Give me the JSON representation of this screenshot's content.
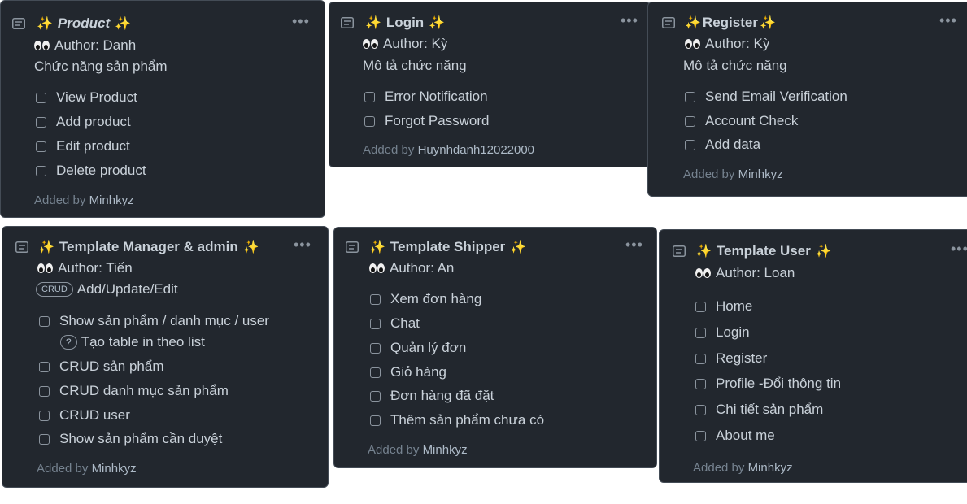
{
  "cards": [
    {
      "title": "Product",
      "author": "Author: Danh",
      "desc": "Chức năng sản phẩm",
      "tasks": [
        "View Product",
        "Add product",
        "Edit product",
        "Delete product"
      ],
      "added_prefix": "Added by",
      "added_by": "Minhkyz"
    },
    {
      "title": "Login",
      "author": "Author: Kỳ",
      "desc": "Mô tả chức năng",
      "tasks": [
        "Error Notification",
        "Forgot Password"
      ],
      "added_prefix": "Added by",
      "added_by": "Huynhdanh12022000"
    },
    {
      "title": "Register",
      "author": "Author: Kỳ",
      "desc": "Mô tả chức năng",
      "tasks": [
        "Send Email Verification",
        "Account Check",
        "Add data"
      ],
      "added_prefix": "Added by",
      "added_by": "Minhkyz"
    },
    {
      "title": "Template Manager & admin",
      "author": "Author: Tiến",
      "badge": "CRUD",
      "desc": "Add/Update/Edit",
      "tasks": [
        "Show sản phẩm / danh mục / user",
        "CRUD sản phẩm",
        "CRUD danh mục sản phẩm",
        "CRUD user",
        "Show sản phẩm cần duyệt"
      ],
      "subnote_badge": "?",
      "subnote": "Tạo table in theo list",
      "added_prefix": "Added by",
      "added_by": "Minhkyz"
    },
    {
      "title": "Template Shipper",
      "author": "Author: An",
      "tasks": [
        "Xem đơn hàng",
        "Chat",
        "Quản lý đơn",
        "Giỏ hàng",
        "Đơn hàng đã đặt",
        "Thêm sản phẩm chưa có"
      ],
      "added_prefix": "Added by",
      "added_by": "Minhkyz"
    },
    {
      "title": "Template User",
      "author": "Author: Loan",
      "tasks": [
        "Home",
        "Login",
        "Register",
        "Profile -Đổi thông tin",
        "Chi tiết sản phẩm",
        "About me"
      ],
      "added_prefix": "Added by",
      "added_by": "Minhkyz"
    }
  ],
  "icons": {
    "note": "note-icon",
    "sparkle": "sparkles-icon",
    "eyes": "eyes-icon",
    "more": "more-icon"
  },
  "colors": {
    "card_bg": "#22272e",
    "border": "#444c56",
    "text": "#c9d1d9",
    "muted": "#768390",
    "sparkle": "#f5d547"
  }
}
